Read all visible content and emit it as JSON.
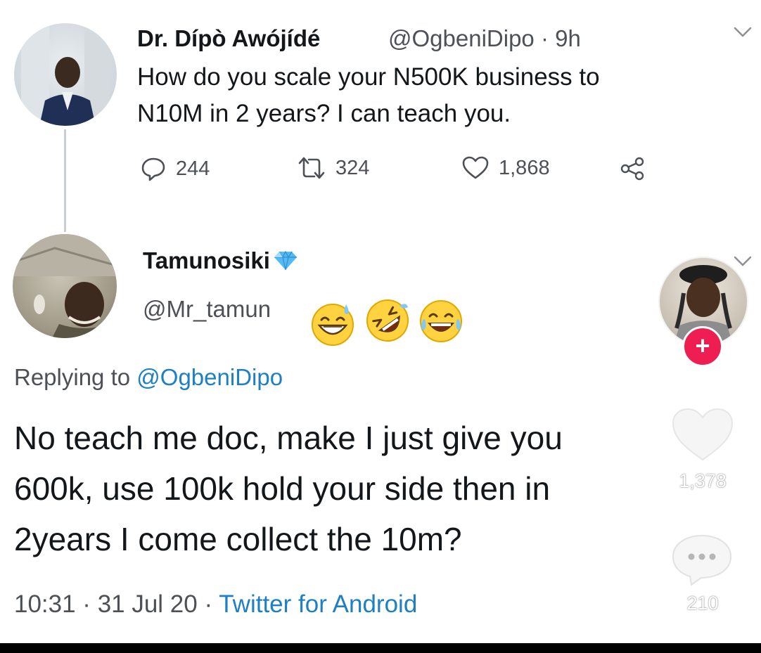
{
  "tweet1": {
    "name": "Dr. Dípò Awójídé",
    "handle": "@OgbeniDipo · 9h",
    "text_line1": "How do you scale your N500K business to",
    "text_line2": "N10M in 2 years? I can teach you.",
    "replies": "244",
    "retweets": "324",
    "likes": "1,868"
  },
  "tweet2": {
    "name": "Tamunosiki",
    "handle": "@Mr_tamun",
    "replying_label": "Replying to",
    "replying_mention": "@OgbeniDipo",
    "text_line1": "No teach me doc, make I just give you",
    "text_line2": "600k, use 100k hold your side then in",
    "text_line3": "2years I come collect the 10m?",
    "time": "10:31 · 31 Jul 20 · ",
    "app": "Twitter for Android"
  },
  "overlay": {
    "follow_label": "+",
    "like_count": "1,378",
    "comment_count": "210"
  },
  "icons": {
    "reply": "speech-bubble-icon",
    "retweet": "retweet-icon",
    "like": "heart-icon",
    "share": "share-icon",
    "verified": "blue-diamond-icon",
    "emojis": [
      "grinning-sweat-emoji",
      "rolling-laughing-emoji",
      "tears-of-joy-emoji"
    ]
  },
  "colors": {
    "link": "#1d7fc4",
    "muted": "#4d5156",
    "follow": "#ee1d52"
  }
}
